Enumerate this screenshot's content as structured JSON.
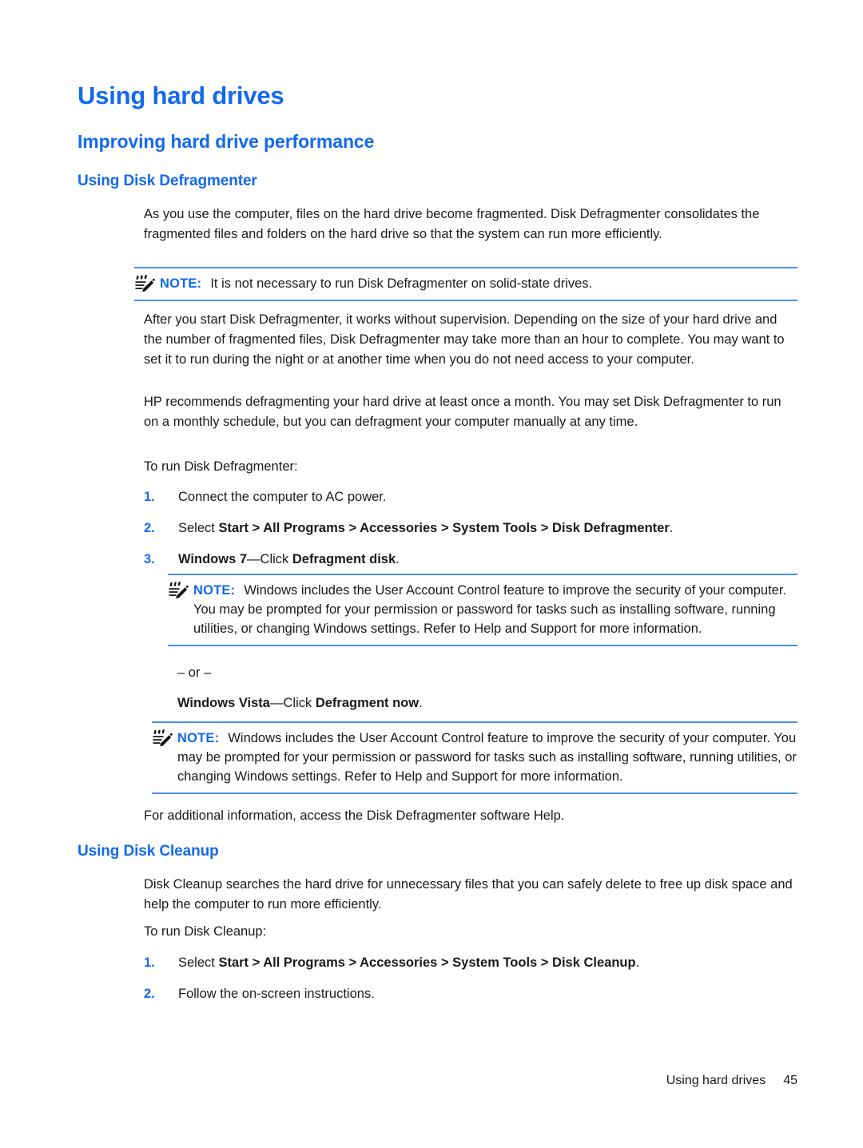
{
  "document": {
    "title": "Using hard drives",
    "section_heading": "Improving hard drive performance"
  },
  "defragmenter": {
    "heading": "Using Disk Defragmenter",
    "intro": "As you use the computer, files on the hard drive become fragmented. Disk Defragmenter consolidates the fragmented files and folders on the hard drive so that the system can run more efficiently.",
    "note_1": {
      "label": "NOTE:",
      "text": "It is not necessary to run Disk Defragmenter on solid-state drives.",
      "icon": "note-pencil-icon"
    },
    "para_2": "After you start Disk Defragmenter, it works without supervision. Depending on the size of your hard drive and the number of fragmented files, Disk Defragmenter may take more than an hour to complete. You may want to set it to run during the night or at another time when you do not need access to your computer.",
    "para_3": "HP recommends defragmenting your hard drive at least once a month. You may set Disk Defragmenter to run on a monthly schedule, but you can defragment your computer manually at any time.",
    "lead_in": "To run Disk Defragmenter:",
    "steps": [
      {
        "num": "1.",
        "prefix": "Connect the computer to AC power.",
        "bold": "",
        "suffix": ""
      },
      {
        "num": "2.",
        "prefix": "Select ",
        "bold": "Start > All Programs > Accessories > System Tools > Disk Defragmenter",
        "suffix": "."
      },
      {
        "num": "3.",
        "bold_1": "Windows 7",
        "mid": "—Click ",
        "bold_2": "Defragment disk",
        "suffix": "."
      }
    ],
    "note_2": {
      "label": "NOTE:",
      "text": "Windows includes the User Account Control feature to improve the security of your computer. You may be prompted for your permission or password for tasks such as installing software, running utilities, or changing Windows settings. Refer to Help and Support for more information.",
      "icon": "note-pencil-icon"
    },
    "or_separator": "– or –",
    "vista_step": {
      "bold_1": "Windows Vista",
      "mid": "—Click ",
      "bold_2": "Defragment now",
      "suffix": "."
    },
    "note_3": {
      "label": "NOTE:",
      "text": "Windows includes the User Account Control feature to improve the security of your computer. You may be prompted for your permission or password for tasks such as installing software, running utilities, or changing Windows settings. Refer to Help and Support for more information.",
      "icon": "note-pencil-icon"
    },
    "closing": "For additional information, access the Disk Defragmenter software Help."
  },
  "cleanup": {
    "heading": "Using Disk Cleanup",
    "intro": "Disk Cleanup searches the hard drive for unnecessary files that you can safely delete to free up disk space and help the computer to run more efficiently.",
    "lead_in": "To run Disk Cleanup:",
    "steps": [
      {
        "num": "1.",
        "prefix": "Select ",
        "bold": "Start > All Programs > Accessories > System Tools > Disk Cleanup",
        "suffix": "."
      },
      {
        "num": "2.",
        "prefix": "Follow the on-screen instructions.",
        "bold": "",
        "suffix": ""
      }
    ]
  },
  "footer": {
    "label": "Using hard drives",
    "page_number": "45"
  },
  "colors": {
    "heading_blue": "#1269EE",
    "rule_blue": "#4A90E8",
    "body_text": "#1a1a1a"
  }
}
